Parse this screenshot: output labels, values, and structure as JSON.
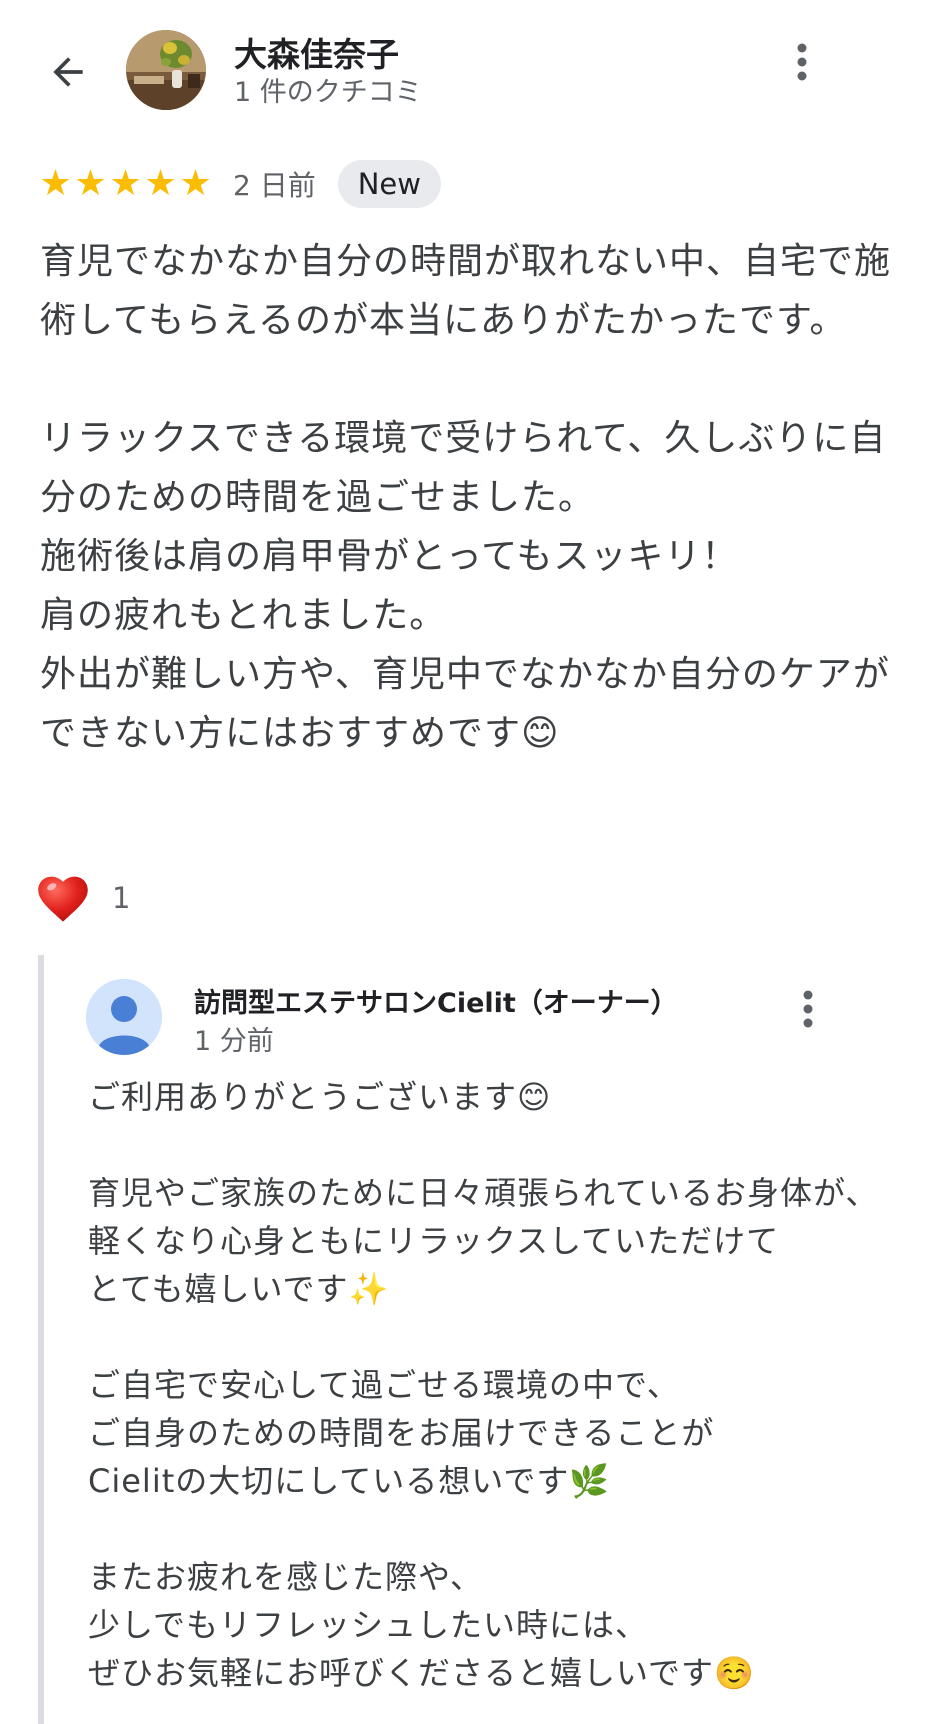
{
  "reviewer": {
    "name": "大森佳奈子",
    "review_count": "1 件のクチコミ"
  },
  "review": {
    "rating": 5,
    "stars": [
      "★",
      "★",
      "★",
      "★",
      "★"
    ],
    "date": "2 日前",
    "badge": "New",
    "text": "育児でなかなか自分の時間が取れない中、自宅で施術してもらえるのが本当にありがたかったです。\n\nリラックスできる環境で受けられて、久しぶりに自分のための時間を過ごせました。\n施術後は肩の肩甲骨がとってもスッキリ！\n肩の疲れもとれました。\n外出が難しい方や、育児中でなかなか自分のケアができない方にはおすすめです😊"
  },
  "reaction": {
    "icon": "heart-icon",
    "count": "1"
  },
  "owner_reply": {
    "name": "訪問型エステサロンCielit（オーナー）",
    "time": "1 分前",
    "text": "ご利用ありがとうございます😊\n\n育児やご家族のために日々頑張られているお身体が、\n軽くなり心身ともにリラックスしていただけて\nとても嬉しいです✨\n\nご自宅で安心して過ごせる環境の中で、\nご自身のための時間をお届けできることが\nCielitの大切にしている想いです🌿\n\nまたお疲れを感じた際や、\n少しでもリフレッシュしたい時には、\nぜひお気軽にお呼びくださると嬉しいです☺️"
  },
  "colors": {
    "star": "#fbbc04",
    "heart": "#e0201b",
    "badge_bg": "#e8eaed",
    "owner_avatar_bg": "#d2e3fc",
    "owner_avatar_fg": "#4a7fd6",
    "divider": "#dadce0"
  },
  "icons": [
    "arrow-back-icon",
    "more-vert-icon",
    "star-icon",
    "heart-icon",
    "person-icon"
  ]
}
